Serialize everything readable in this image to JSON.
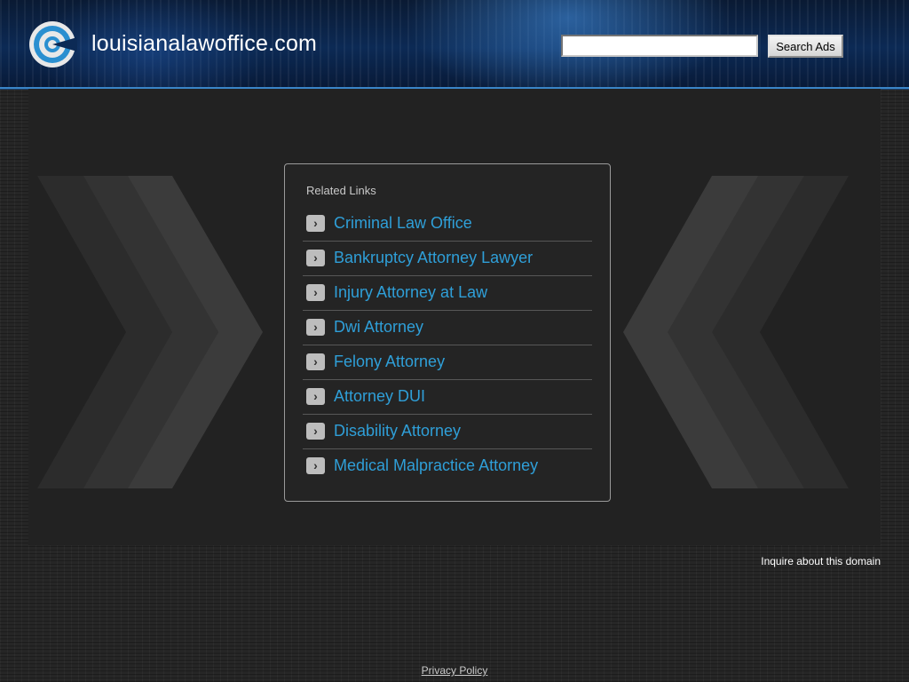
{
  "header": {
    "site_name": "louisianalawoffice.com",
    "search_placeholder": "",
    "search_button_label": "Search Ads",
    "logo_icon": "circular-search-logo-icon"
  },
  "related_links": {
    "title": "Related Links",
    "arrow_icon": "chevron-right-icon",
    "items": [
      {
        "label": "Criminal Law Office"
      },
      {
        "label": "Bankruptcy Attorney Lawyer"
      },
      {
        "label": "Injury Attorney at Law"
      },
      {
        "label": "Dwi Attorney"
      },
      {
        "label": "Felony Attorney"
      },
      {
        "label": "Attorney DUI"
      },
      {
        "label": "Disability Attorney"
      },
      {
        "label": "Medical Malpractice Attorney"
      }
    ]
  },
  "footer": {
    "inquire_label": "Inquire about this domain",
    "privacy_label": "Privacy Policy"
  },
  "colors": {
    "link": "#2f9fd8",
    "header_accent": "#3a85c8",
    "background": "#262626"
  }
}
